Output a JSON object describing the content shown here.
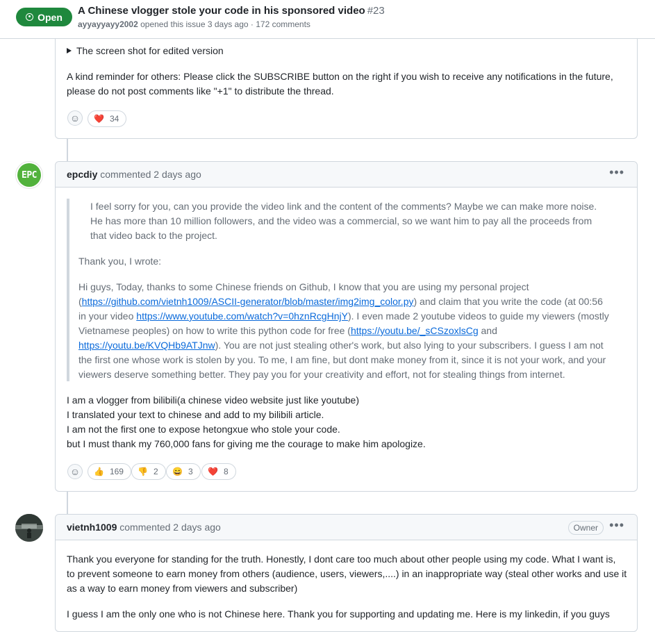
{
  "issue": {
    "state": "Open",
    "title": "A Chinese vlogger stole your code in his sponsored video",
    "number": "#23",
    "author": "ayyayyayy2002",
    "meta": "opened this issue 3 days ago · 172 comments"
  },
  "comment0": {
    "details_summary": "The screen shot for edited version",
    "body_line1": "A kind reminder for others: Please click the SUBSCRIBE button on the right if you wish to receive any notifications in the future,",
    "body_line2": "please do not post comments like \"+1\" to distribute the thread.",
    "reactions": [
      {
        "emoji": "❤️",
        "count": "34"
      }
    ]
  },
  "comment1": {
    "author": "epcdiy",
    "avatar_text": "EPC",
    "action": "commented 2 days ago",
    "quote": [
      "I feel sorry for you, can you provide the video link and the content of the comments? Maybe we can make more noise.",
      "He has more than 10 million followers, and the video was a commercial, so we want him to pay all the proceeds from",
      "that video back to the project."
    ],
    "quote_thanks": "Thank you, I wrote:",
    "q2_l1": "Hi guys, Today, thanks to some Chinese friends on Github, I know that you are using my personal project",
    "q2_l2_pre": "(",
    "q2_l2_link": "https://github.com/vietnh1009/ASCII-generator/blob/master/img2img_color.py",
    "q2_l2_post": ") and claim that you write the code (at 00:56",
    "q2_l3_pre": "in your video ",
    "q2_l3_link": "https://www.youtube.com/watch?v=0hznRcgHnjY",
    "q2_l3_post": "). I even made 2 youtube videos to guide my viewers (mostly",
    "q2_l4_pre": "Vietnamese peoples) on how to write this python code for free (",
    "q2_l4_link": "https://youtu.be/_sCSzoxlsCg",
    "q2_l4_post": " and",
    "q2_l5_link": "https://youtu.be/KVQHb9ATJnw",
    "q2_l5_post": "). You are not just stealing other's work, but also lying to your subscribers. I guess I am not",
    "q2_l6": "the first one whose work is stolen by you. To me, I am fine, but dont make money from it, since it is not your work, and your",
    "q2_l7": "viewers deserve something better. They pay you for your creativity and effort, not for stealing things from internet.",
    "body": [
      "I am a vlogger from bilibili(a chinese video website just like youtube)",
      "I translated your text to chinese and add to my bilibili article.",
      "I am not the first one to expose hetongxue who stole your code.",
      "but I must thank my 760,000 fans for giving me the courage to make him apologize."
    ],
    "reactions": [
      {
        "emoji": "👍",
        "count": "169"
      },
      {
        "emoji": "👎",
        "count": "2"
      },
      {
        "emoji": "😄",
        "count": "3"
      },
      {
        "emoji": "❤️",
        "count": "8"
      }
    ]
  },
  "comment2": {
    "author": "vietnh1009",
    "action": "commented 2 days ago",
    "badge": "Owner",
    "body": [
      "Thank you everyone for standing for the truth. Honestly, I dont care too much about other people using my code. What I want is,",
      "to prevent someone to earn money from others (audience, users, viewers,....) in an inappropriate way (steal other works and use it",
      "as a way to earn money from viewers and subscriber)",
      "I guess I am the only one who is not Chinese here. Thank you for supporting and updating me. Here is my linkedin, if you guys"
    ]
  },
  "colors": {
    "open_green": "#1f883d",
    "link_blue": "#0969da",
    "muted": "#656d76",
    "border": "#d0d7de",
    "heart": "#cf222e"
  },
  "icons": [
    "issue-opened-icon",
    "triangle-right-icon",
    "smiley-icon",
    "kebab-horizontal-icon"
  ]
}
